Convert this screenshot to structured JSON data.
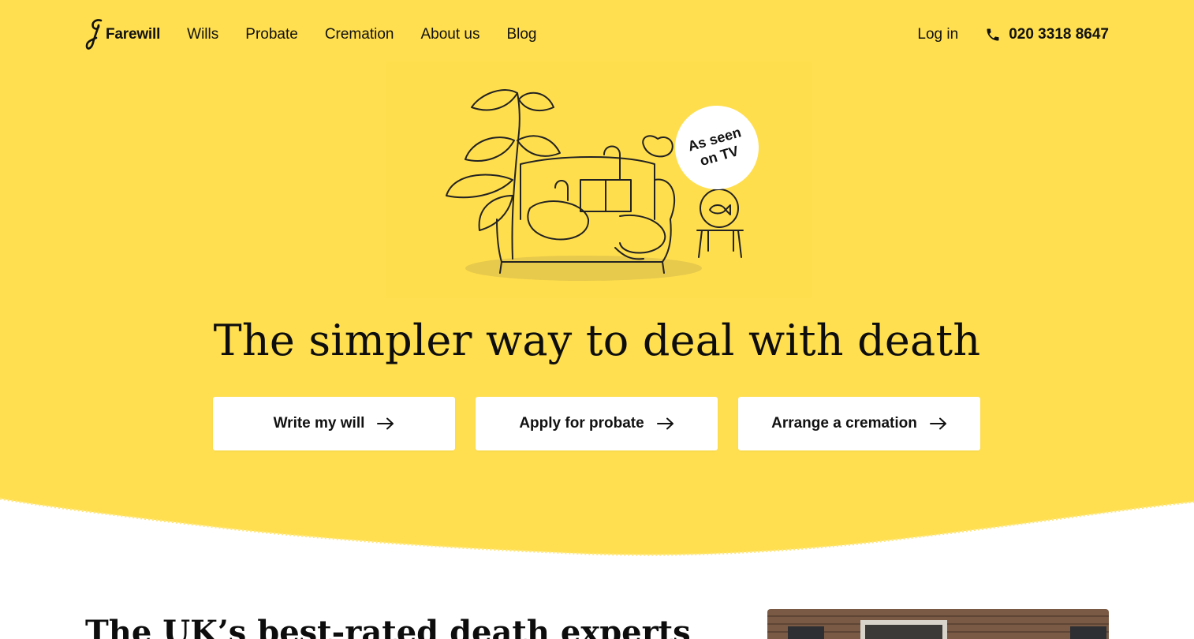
{
  "colors": {
    "hero_yellow": "#FFDF4F",
    "text": "#111111",
    "button_bg": "#FFFFFF"
  },
  "header": {
    "logo_text": "Farewill",
    "nav": [
      {
        "label": "Wills"
      },
      {
        "label": "Probate"
      },
      {
        "label": "Cremation"
      },
      {
        "label": "About us"
      },
      {
        "label": "Blog"
      }
    ],
    "login_label": "Log in",
    "phone": "020 3318 8647",
    "phone_icon": "phone-icon"
  },
  "hero": {
    "badge_line1": "As seen",
    "badge_line2": "on TV",
    "headline": "The simpler way to deal with death",
    "ctas": [
      {
        "label": "Write my will",
        "icon": "arrow-right-icon"
      },
      {
        "label": "Apply for probate",
        "icon": "arrow-right-icon"
      },
      {
        "label": "Arrange a cremation",
        "icon": "arrow-right-icon"
      }
    ]
  },
  "section": {
    "title": "The UK’s best-rated death experts"
  }
}
